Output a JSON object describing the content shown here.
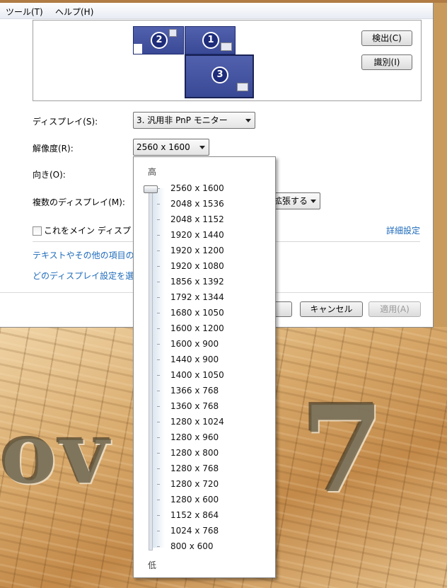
{
  "menu": {
    "tools": "ツール(T)",
    "help": "ヘルプ(H)"
  },
  "monitors": [
    {
      "number": "2"
    },
    {
      "number": "1"
    },
    {
      "number": "3"
    }
  ],
  "buttons": {
    "detect": "検出(C)",
    "identify": "識別(I)",
    "cancel": "キャンセル",
    "apply": "適用(A)"
  },
  "display": {
    "label": "ディスプレイ(S):",
    "value": "3. 汎用非 PnP モニター"
  },
  "resolution": {
    "label": "解像度(R):",
    "value": "2560 x 1600"
  },
  "orientation": {
    "label": "向き(O):"
  },
  "multiple_displays": {
    "label": "複数のディスプレイ(M):",
    "value": "拡張する"
  },
  "main_display_checkbox": {
    "label": "これをメイン ディスプ",
    "checked": false
  },
  "advanced_settings": "詳細設定",
  "links": {
    "text_size": "テキストやその他の項目の",
    "which_settings": "どのディスプレイ設定を選"
  },
  "dropdown": {
    "high_label": "高",
    "low_label": "低",
    "selected": "2560 x 1600",
    "options": [
      "2560 x 1600",
      "2048 x 1536",
      "2048 x 1152",
      "1920 x 1440",
      "1920 x 1200",
      "1920 x 1080",
      "1856 x 1392",
      "1792 x 1344",
      "1680 x 1050",
      "1600 x 1200",
      "1600 x 900",
      "1440 x 900",
      "1400 x 1050",
      "1366 x 768",
      "1360 x 768",
      "1280 x 1024",
      "1280 x 960",
      "1280 x 800",
      "1280 x 768",
      "1280 x 720",
      "1280 x 600",
      "1152 x 864",
      "1024 x 768",
      "800 x 600"
    ]
  },
  "wallpaper": {
    "text_left": "ov",
    "text_right": "7"
  }
}
